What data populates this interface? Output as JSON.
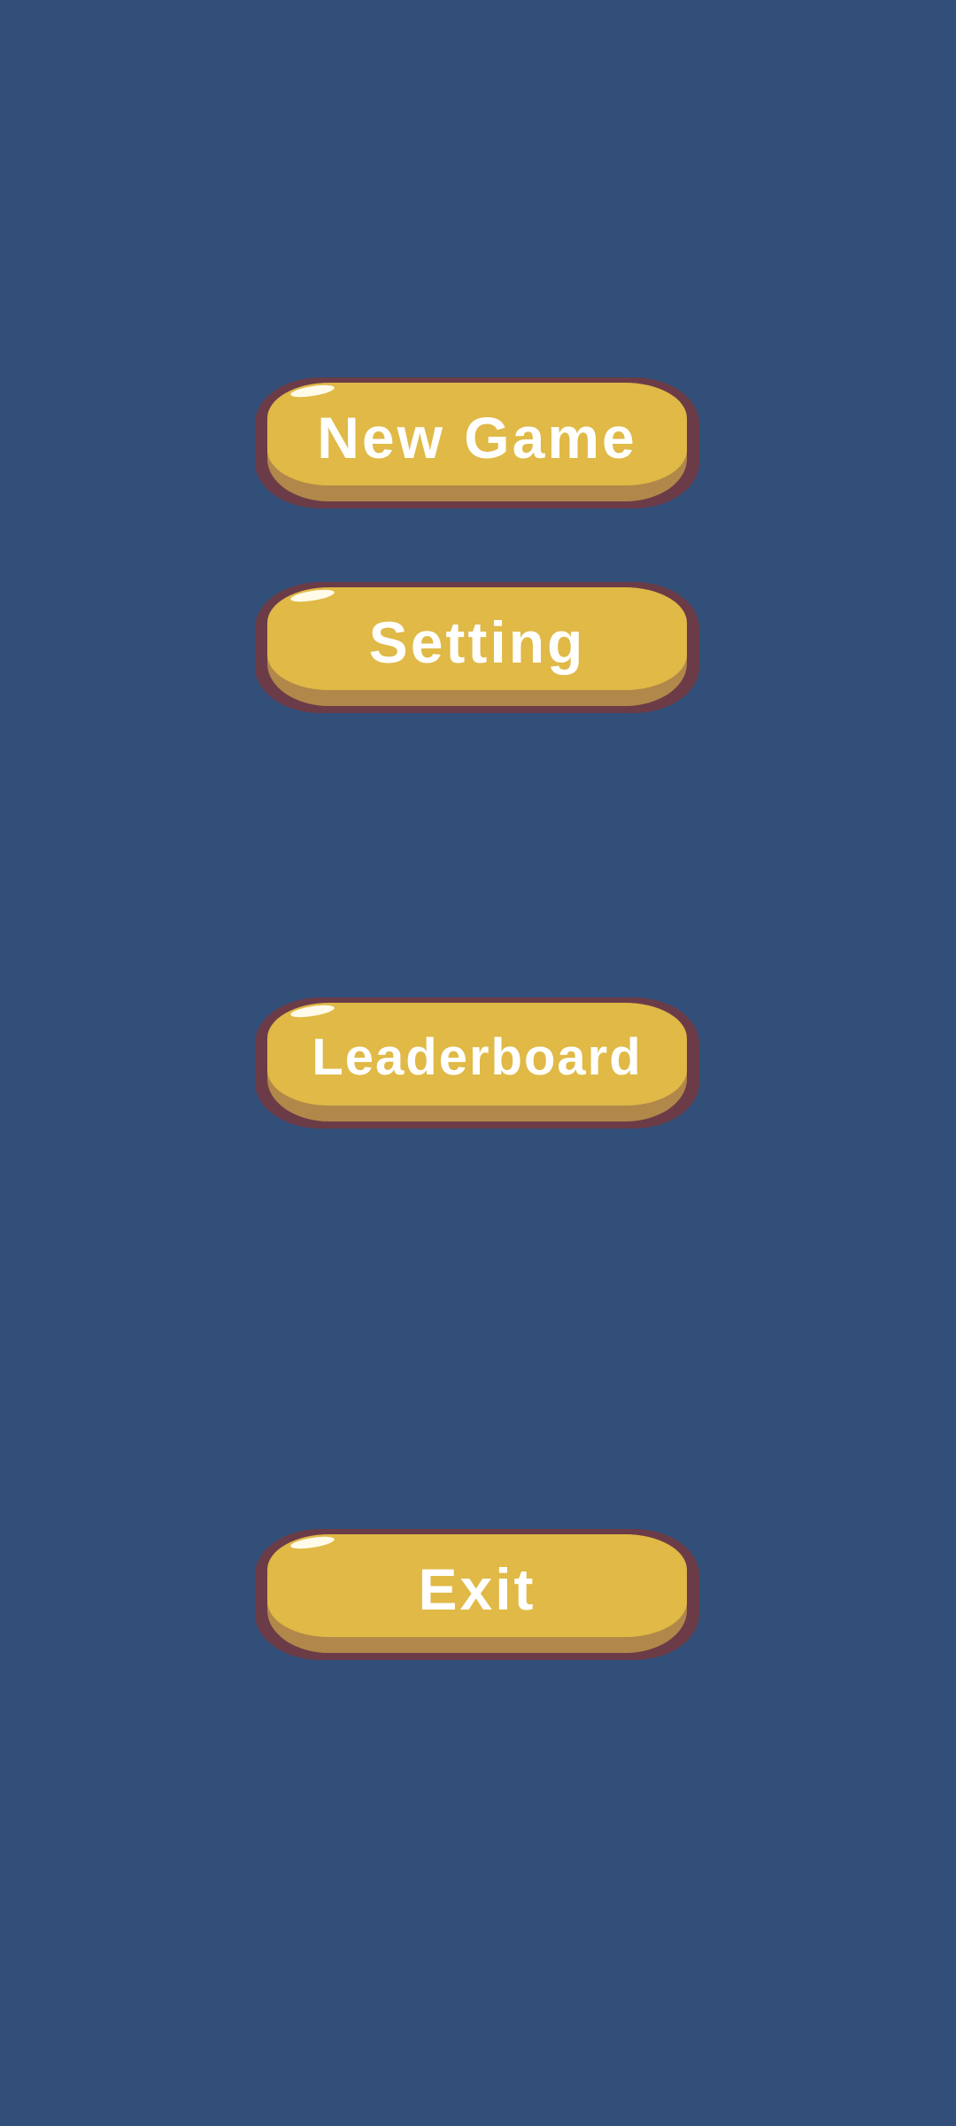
{
  "menu": {
    "new_game_label": "New Game",
    "setting_label": "Setting",
    "leaderboard_label": "Leaderboard",
    "exit_label": "Exit"
  },
  "colors": {
    "background": "#324f7a",
    "button_face": "#e0b946",
    "button_shadow": "#b1884a",
    "button_outline": "#6b3c47",
    "label_text": "#ffffff"
  }
}
